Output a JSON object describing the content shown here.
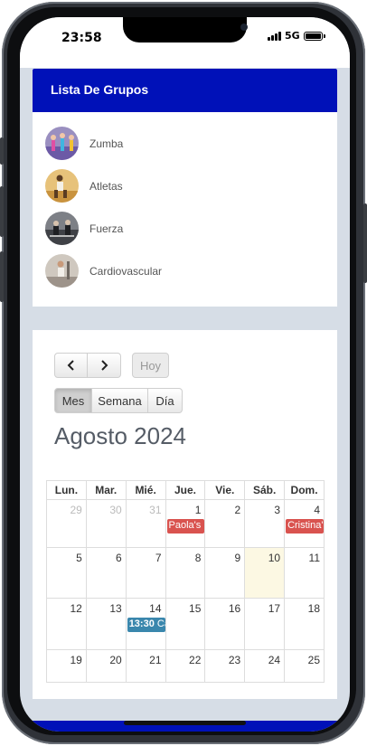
{
  "status": {
    "time": "23:58",
    "network": "5G"
  },
  "groups": {
    "title": "Lista De Grupos",
    "items": [
      {
        "name": "Zumba"
      },
      {
        "name": "Atletas"
      },
      {
        "name": "Fuerza"
      },
      {
        "name": "Cardiovascular"
      }
    ]
  },
  "calendar": {
    "prev_icon": "chevron-left-icon",
    "next_icon": "chevron-right-icon",
    "today_label": "Hoy",
    "views": [
      "Mes",
      "Semana",
      "Día"
    ],
    "active_view": "Mes",
    "title": "Agosto 2024",
    "weekdays": [
      "Lun.",
      "Mar.",
      "Mié.",
      "Jue.",
      "Vie.",
      "Sáb.",
      "Dom."
    ],
    "weeks": [
      [
        "29",
        "30",
        "31",
        "1",
        "2",
        "3",
        "4"
      ],
      [
        "5",
        "6",
        "7",
        "8",
        "9",
        "10",
        "11"
      ],
      [
        "12",
        "13",
        "14",
        "15",
        "16",
        "17",
        "18"
      ],
      [
        "19",
        "20",
        "21",
        "22",
        "23",
        "24",
        "25"
      ]
    ],
    "events": [
      {
        "day": "1",
        "time": "",
        "label": "Paola's I",
        "color": "#d9534f"
      },
      {
        "day": "4",
        "time": "",
        "label": "Cristina'",
        "color": "#d9534f"
      },
      {
        "day": "14",
        "time": "13:30",
        "label": "Ca",
        "color": "#3a87ad"
      }
    ],
    "today_day": "10",
    "colors": {
      "header": "#0011b8",
      "today_bg": "#fcf8e3"
    }
  }
}
